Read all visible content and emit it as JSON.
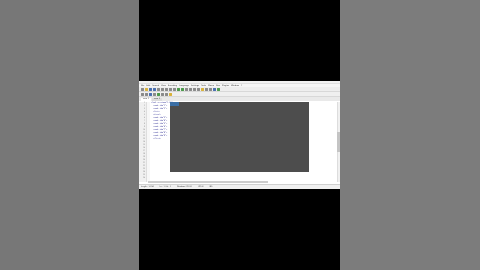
{
  "app": {
    "menu": [
      "File",
      "Edit",
      "Search",
      "View",
      "Encoding",
      "Language",
      "Settings",
      "Tools",
      "Macro",
      "Run",
      "Plugins",
      "Window",
      "?"
    ],
    "tabs": [
      "new 1",
      "new 2"
    ],
    "gutter_lines": [
      "1",
      "2",
      "3",
      "4",
      "5",
      "6",
      "7",
      "8",
      "9",
      "10",
      "11",
      "12",
      "13",
      "14",
      "15",
      "16",
      "17",
      "18",
      "19",
      "20",
      "21",
      "22",
      "23",
      "24",
      "25",
      "26"
    ],
    "code_lines": [
      "<?xml version=\"1.0\"?>",
      "  <node id=\"1\">",
      "  <node id=\"2\">",
      "",
      "  <list>",
      "  <item/>",
      "",
      "  <node id=\"3\">",
      "  <node id=\"4\">",
      "",
      "",
      "  <node id=\"5\">",
      "",
      "  <node id=\"6\">",
      "",
      "",
      "  <node id=\"7\">",
      "",
      "",
      "  <node id=\"8\">",
      "",
      "",
      "  <node id=\"9\">",
      "",
      "",
      "  </list>"
    ],
    "status": [
      "length : 1,234",
      "Ln : 1  Col : 1",
      "Windows (CR LF)",
      "UTF-8",
      "INS"
    ]
  },
  "colors": {
    "overlay": "#4d4d4d",
    "background": "#777777"
  }
}
